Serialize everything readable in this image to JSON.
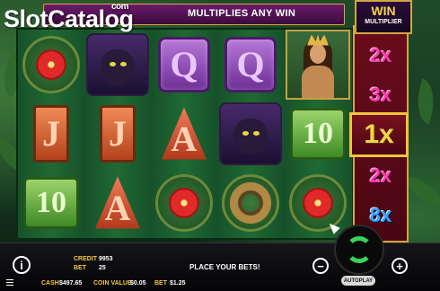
{
  "watermark": {
    "brand": "Slot",
    "brand2": "Catalog",
    "suffix": "com"
  },
  "banner": {
    "text": "MULTIPLIES ANY WIN"
  },
  "multiplier": {
    "title": "WIN",
    "subtitle": "MULTIPLIER",
    "values": [
      {
        "label": "2x",
        "color": "pink",
        "active": false
      },
      {
        "label": "3x",
        "color": "pink",
        "active": false
      },
      {
        "label": "1x",
        "color": "gold",
        "active": true
      },
      {
        "label": "2x",
        "color": "pink",
        "active": false
      },
      {
        "label": "8x",
        "color": "blue",
        "active": false
      }
    ]
  },
  "reels": [
    [
      "flower",
      "J",
      "10"
    ],
    [
      "panther",
      "J",
      "A"
    ],
    [
      "Q",
      "A",
      "flower"
    ],
    [
      "Q",
      "panther",
      "snake"
    ],
    [
      "goddess",
      "10",
      "flower"
    ]
  ],
  "symbol_text": {
    "Q": "Q",
    "J": "J",
    "A": "A",
    "ten": "10"
  },
  "bottom_bar": {
    "info_label": "i",
    "credit_label": "CREDIT",
    "credit_value": "9953",
    "bet_label": "BET",
    "bet_value": "25",
    "message": "PLACE YOUR BETS!",
    "cash_label": "CASH",
    "cash_value": "$497.65",
    "coin_value_label": "COIN VALUE",
    "coin_value": "$0.05",
    "bet2_label": "BET",
    "bet2_value": "$1.25",
    "minus_label": "−",
    "plus_label": "+",
    "menu_icon": "menu-icon",
    "autoplay_label": "AUTOPLAY"
  },
  "colors": {
    "multiplier_pink": "#ff3ab0",
    "multiplier_blue": "#3aa0ff",
    "multiplier_gold": "#f4d44a",
    "spin_green": "#38d35a",
    "label_gold": "#f2c84b"
  }
}
